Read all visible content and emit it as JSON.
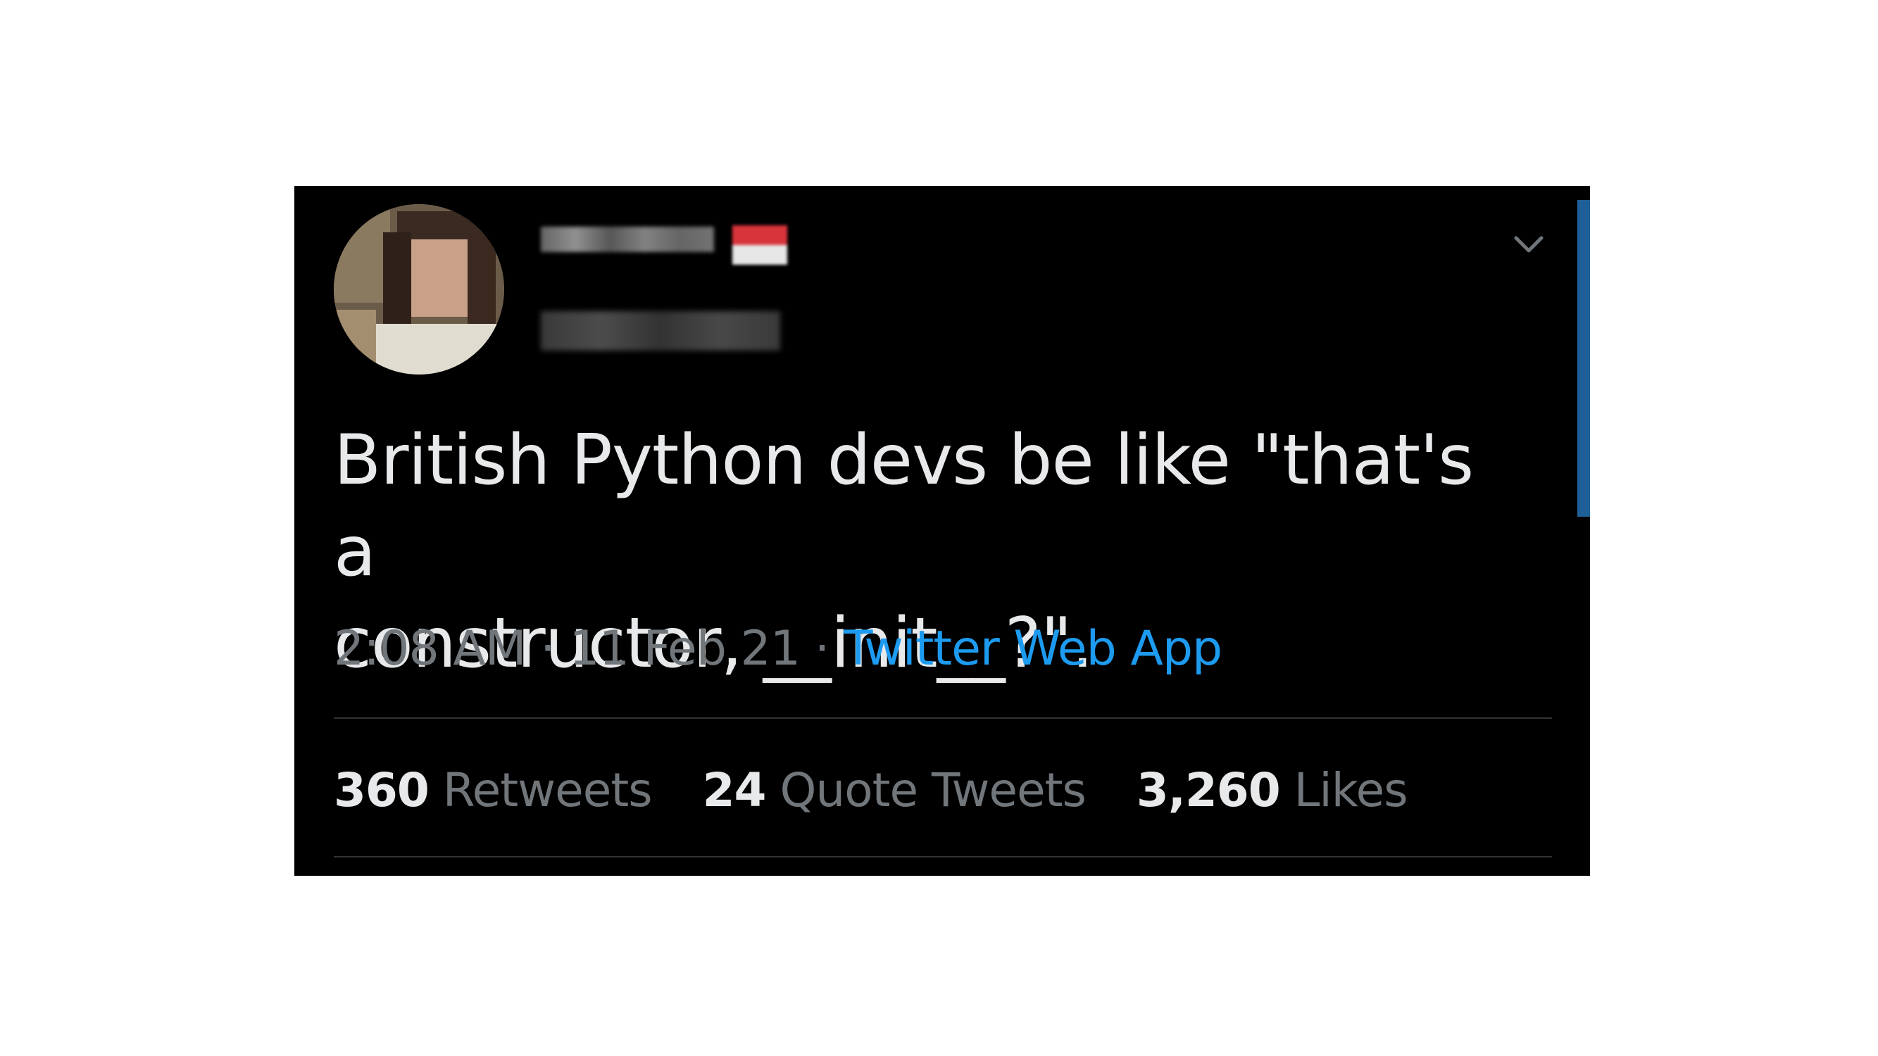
{
  "tweet": {
    "text_line1": "British Python devs be like \"that's a",
    "text_line2": "constructor, __init__?\".",
    "time": "2:08 AM",
    "separator": "·",
    "date": "11 Feb 21",
    "source": "Twitter Web App"
  },
  "stats": {
    "retweets_count": "360",
    "retweets_label": "Retweets",
    "quotes_count": "24",
    "quotes_label": "Quote Tweets",
    "likes_count": "3,260",
    "likes_label": "Likes"
  },
  "icons": {
    "menu": "chevron-down-icon"
  },
  "colors": {
    "background": "#000000",
    "text": "#e7e9ea",
    "muted": "#71767b",
    "link": "#1d9bf0",
    "scrollbar": "#1d5f96"
  }
}
